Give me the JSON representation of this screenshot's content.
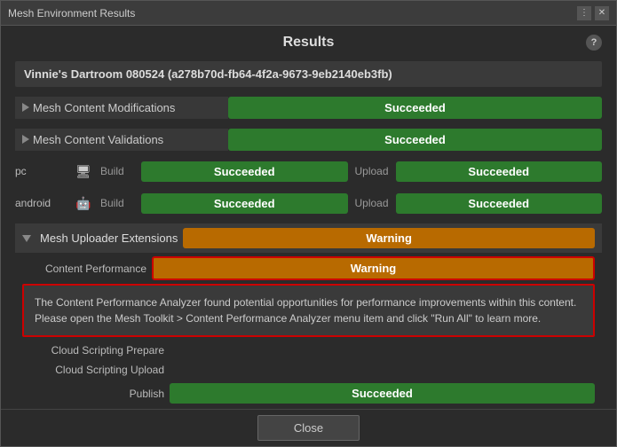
{
  "window": {
    "title": "Mesh Environment Results",
    "controls": {
      "menu_icon": "⋮",
      "close_icon": "✕"
    }
  },
  "results": {
    "heading": "Results",
    "help_label": "?",
    "env_title": "Vinnie's Dartroom 080524 (a278b70d-fb64-4f2a-9673-9eb2140eb3fb)",
    "rows": [
      {
        "label": "Mesh Content Modifications",
        "badge": "Succeeded",
        "badge_type": "green",
        "arrow": "right"
      },
      {
        "label": "Mesh Content Validations",
        "badge": "Succeeded",
        "badge_type": "green",
        "arrow": "right"
      }
    ],
    "platforms": [
      {
        "name": "pc",
        "icon": "🖥",
        "build_label": "Build",
        "build_badge": "Succeeded",
        "upload_label": "Upload",
        "upload_badge": "Succeeded"
      },
      {
        "name": "android",
        "icon": "🤖",
        "build_label": "Build",
        "build_badge": "Succeeded",
        "upload_label": "Upload",
        "upload_badge": "Succeeded"
      }
    ],
    "uploader": {
      "label": "Mesh Uploader Extensions",
      "header_badge": "Warning",
      "content_performance": {
        "label": "Content Performance",
        "badge": "Warning"
      },
      "tooltip": "The Content Performance Analyzer found potential opportunities for performance improvements within this content. Please open the Mesh Toolkit > Content Performance Analyzer menu item and click \"Run All\" to learn more.",
      "cloud_scripting_prepare": {
        "label": "Cloud Scripting Prepare",
        "badge": ""
      },
      "cloud_scripting_upload": {
        "label": "Cloud Scripting Upload",
        "badge": ""
      },
      "publish": {
        "label": "Publish",
        "badge": "Succeeded"
      }
    }
  },
  "footer": {
    "close_label": "Close"
  }
}
